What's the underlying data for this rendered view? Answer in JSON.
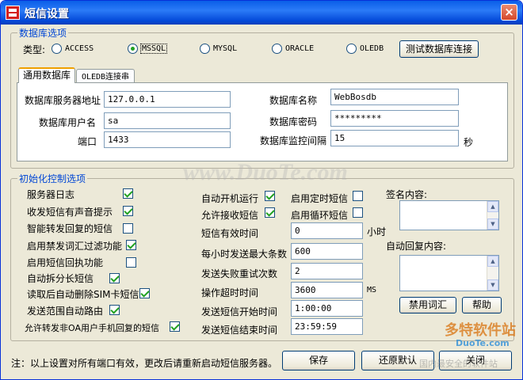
{
  "window": {
    "title": "短信设置",
    "close_glyph": "×"
  },
  "database": {
    "legend": "数据库选项",
    "type_label": "类型:",
    "options": [
      "ACCESS",
      "MSSQL",
      "MYSQL",
      "ORACLE",
      "OLEDB"
    ],
    "selected": "MSSQL",
    "test_button": "测试数据库连接",
    "tabs": [
      "通用数据库",
      "OLEDB连接串"
    ],
    "fields": {
      "server_label": "数据库服务器地址",
      "server_value": "127.0.0.1",
      "dbname_label": "数据库名称",
      "dbname_value": "WebBosdb",
      "user_label": "数据库用户名",
      "user_value": "sa",
      "password_label": "数据库密码",
      "password_value": "*********",
      "port_label": "端口",
      "port_value": "1433",
      "interval_label": "数据库监控间隔",
      "interval_value": "15",
      "interval_unit": "秒"
    }
  },
  "init": {
    "legend": "初始化控制选项",
    "checks_left": [
      {
        "label": "服务器日志",
        "checked": true
      },
      {
        "label": "收发短信有声音提示",
        "checked": true
      },
      {
        "label": "智能转发回复的短信",
        "checked": false
      },
      {
        "label": "启用禁发词汇过滤功能",
        "checked": true
      },
      {
        "label": "启用短信回执功能",
        "checked": false
      },
      {
        "label": "自动拆分长短信",
        "checked": true
      },
      {
        "label": "读取后自动删除SIM卡短信",
        "checked": true
      },
      {
        "label": "发送范围自动路由",
        "checked": true
      },
      {
        "label": "允许转发非OA用户手机回复的短信",
        "checked": true
      }
    ],
    "checks_mid": [
      {
        "label": "自动开机运行",
        "checked": true
      },
      {
        "label": "启用定时短信",
        "checked": false
      },
      {
        "label": "允许接收短信",
        "checked": true
      },
      {
        "label": "启用循环短信",
        "checked": false
      }
    ],
    "fields": [
      {
        "label": "短信有效时间",
        "value": "0",
        "unit": "小时"
      },
      {
        "label": "每小时发送最大条数",
        "value": "600",
        "unit": ""
      },
      {
        "label": "发送失败重试次数",
        "value": "2",
        "unit": ""
      },
      {
        "label": "操作超时时间",
        "value": "3600",
        "unit": "MS"
      },
      {
        "label": "发送短信开始时间",
        "value": "1:00:00",
        "unit": ""
      },
      {
        "label": "发送短信结束时间",
        "value": "23:59:59",
        "unit": ""
      }
    ],
    "signature_label": "签名内容:",
    "auto_reply_label": "自动回复内容:",
    "forbidden_words_button": "禁用词汇",
    "help_button": "帮助"
  },
  "footer": {
    "note": "注：以上设置对所有端口有效，更改后请重新启动短信服务器。",
    "save_button": "保存",
    "restore_button": "还原默认",
    "close_button": "关闭"
  },
  "watermark": {
    "brand": "多特软件站",
    "url": "DuoTe.com",
    "slogan": "国内最安全的软件站",
    "center": "www.DuoTe.com"
  },
  "colors": {
    "title_bar": "#0a5ee8",
    "legend_text": "#0046d5",
    "check_mark": "#21a121",
    "window_bg": "#ece9d8"
  }
}
